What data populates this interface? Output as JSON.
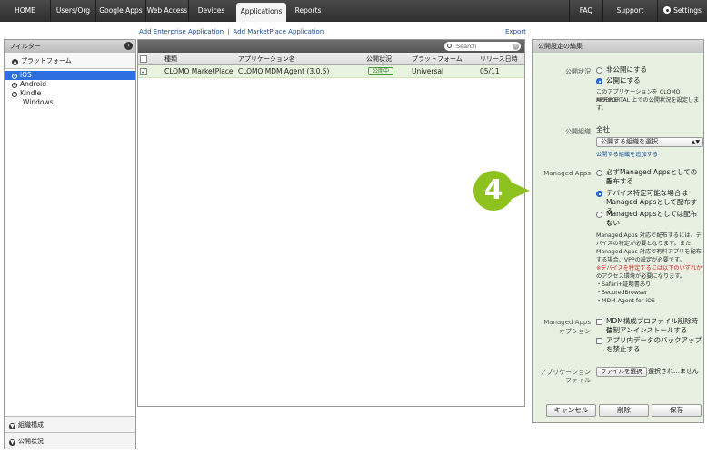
{
  "nav": {
    "items": [
      {
        "label": "HOME"
      },
      {
        "label": "Users/Org"
      },
      {
        "label": "Google Apps"
      },
      {
        "label": "Web Access"
      },
      {
        "label": "Devices"
      },
      {
        "label": "Applications"
      },
      {
        "label": "Reports"
      },
      {
        "label": "FAQ"
      },
      {
        "label": "Support"
      },
      {
        "label": "Settings"
      }
    ],
    "active": "Applications"
  },
  "actions": {
    "add_enterprise": "Add Enterprise Application",
    "separator": "|",
    "add_marketplace": "Add MarketPlace Application",
    "export": "Export"
  },
  "filter": {
    "title": "フィルター",
    "platform_section": "プラットフォーム",
    "platforms": [
      "iOS",
      "Android",
      "Kindle",
      "Windows"
    ],
    "selected_platform": "iOS",
    "bottom_sections": [
      "組織構成",
      "公開状況"
    ]
  },
  "table": {
    "search_placeholder": "Search",
    "columns": [
      "種類",
      "アプリケーション名",
      "公開状況",
      "プラットフォーム",
      "リリース日時"
    ],
    "rows": [
      {
        "type": "CLOMO MarketPlace",
        "name": "CLOMO MDM Agent (3.0.5)",
        "status": "公開中",
        "platform": "Universal",
        "release": "05/11",
        "checked": true
      }
    ]
  },
  "edit": {
    "title": "公開設定の編集",
    "publish_label": "公開状況",
    "publish_opt_private": "非公開にする",
    "publish_opt_public": "公開にする",
    "publish_note_1": "このアプリケーションを CLOMO MOBILE",
    "publish_note_2": "APP PORTAL 上での公開状況を設定しま",
    "publish_note_3": "す。",
    "org_label": "公開組織",
    "org_value": "全社",
    "org_select": "公開する組織を選択",
    "org_add_link": "公開する組織を追加する",
    "managed_label": "Managed Apps",
    "managed_opt1_a": "必ずManaged Appsとしてのみ",
    "managed_opt1_b": "配布する",
    "managed_opt2_a": "デバイス特定可能な場合は",
    "managed_opt2_b": "Managed Appsとして配布する",
    "managed_opt3_a": "Managed Appsとしては配布し",
    "managed_opt3_b": "ない",
    "managed_note_1": "Managed Apps 対応で配布するには、デ",
    "managed_note_2": "バイスの特定が必要となります。また、",
    "managed_note_3": "Managed Apps 対応で有料アプリを配布",
    "managed_note_4": "する場合、VPPの設定が必要です。",
    "managed_warn_1": "※デバイスを特定するには以下のいずれか",
    "managed_warn_2": "のアクセス環境が必要になります。",
    "managed_env_1": "・Safari+証明書あり",
    "managed_env_2": "・SecuredBrowser",
    "managed_env_3": "・MDM Agent for iOS",
    "option_label_1": "Managed Apps",
    "option_label_2": "オプション",
    "option1_a": "MDM構成プロファイル削除時に",
    "option1_b": "強制アンインストールする",
    "option2_a": "アプリ内データのバックアップ",
    "option2_b": "を禁止する",
    "file_label_1": "アプリケーション",
    "file_label_2": "ファイル",
    "file_button": "ファイルを選択",
    "file_status": "選択され…ません",
    "cancel": "キャンセル",
    "delete": "削除",
    "save": "保存"
  },
  "callout": {
    "number": "4",
    "color": "#8dc21f"
  }
}
